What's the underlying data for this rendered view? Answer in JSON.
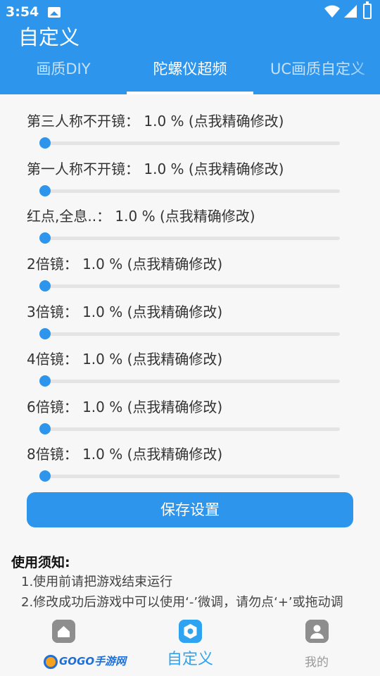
{
  "status_bar": {
    "time": "3:54"
  },
  "app": {
    "title": "自定义"
  },
  "tabs": [
    {
      "label": "画质DIY",
      "active": false
    },
    {
      "label": "陀螺仪超频",
      "active": true
    },
    {
      "label": "UC画质自定义",
      "active": false
    }
  ],
  "settings": [
    {
      "label": "第三人称不开镜：  1.0 %  (点我精确修改)",
      "value_percent": 1.0
    },
    {
      "label": "第一人称不开镜：  1.0 %  (点我精确修改)",
      "value_percent": 1.0
    },
    {
      "label": "红点,全息..：  1.0 %  (点我精确修改)",
      "value_percent": 1.0
    },
    {
      "label": "2倍镜：  1.0 %  (点我精确修改)",
      "value_percent": 1.0
    },
    {
      "label": "3倍镜：  1.0 %  (点我精确修改)",
      "value_percent": 1.0
    },
    {
      "label": "4倍镜：  1.0 %  (点我精确修改)",
      "value_percent": 1.0
    },
    {
      "label": "6倍镜：  1.0 %  (点我精确修改)",
      "value_percent": 1.0
    },
    {
      "label": "8倍镜：  1.0 %  (点我精确修改)",
      "value_percent": 1.0
    }
  ],
  "save_button": {
    "label": "保存设置"
  },
  "notice": {
    "title": "使用须知:",
    "items": [
      "1.使用前请把游戏结束运行",
      "2.修改成功后游戏中可以使用‘-’微调，请勿点‘+’或拖动调"
    ]
  },
  "bottom_nav": {
    "items": [
      {
        "label": "",
        "icon": "home-icon",
        "active": false
      },
      {
        "label": "自定义",
        "icon": "settings-hex-icon",
        "active": true
      },
      {
        "label": "我的",
        "icon": "user-icon",
        "active": false
      }
    ],
    "logo_text": "GOGO手游网"
  },
  "colors": {
    "primary": "#2e95ec",
    "track": "#e4e4e4",
    "background": "#f7f7f7"
  }
}
